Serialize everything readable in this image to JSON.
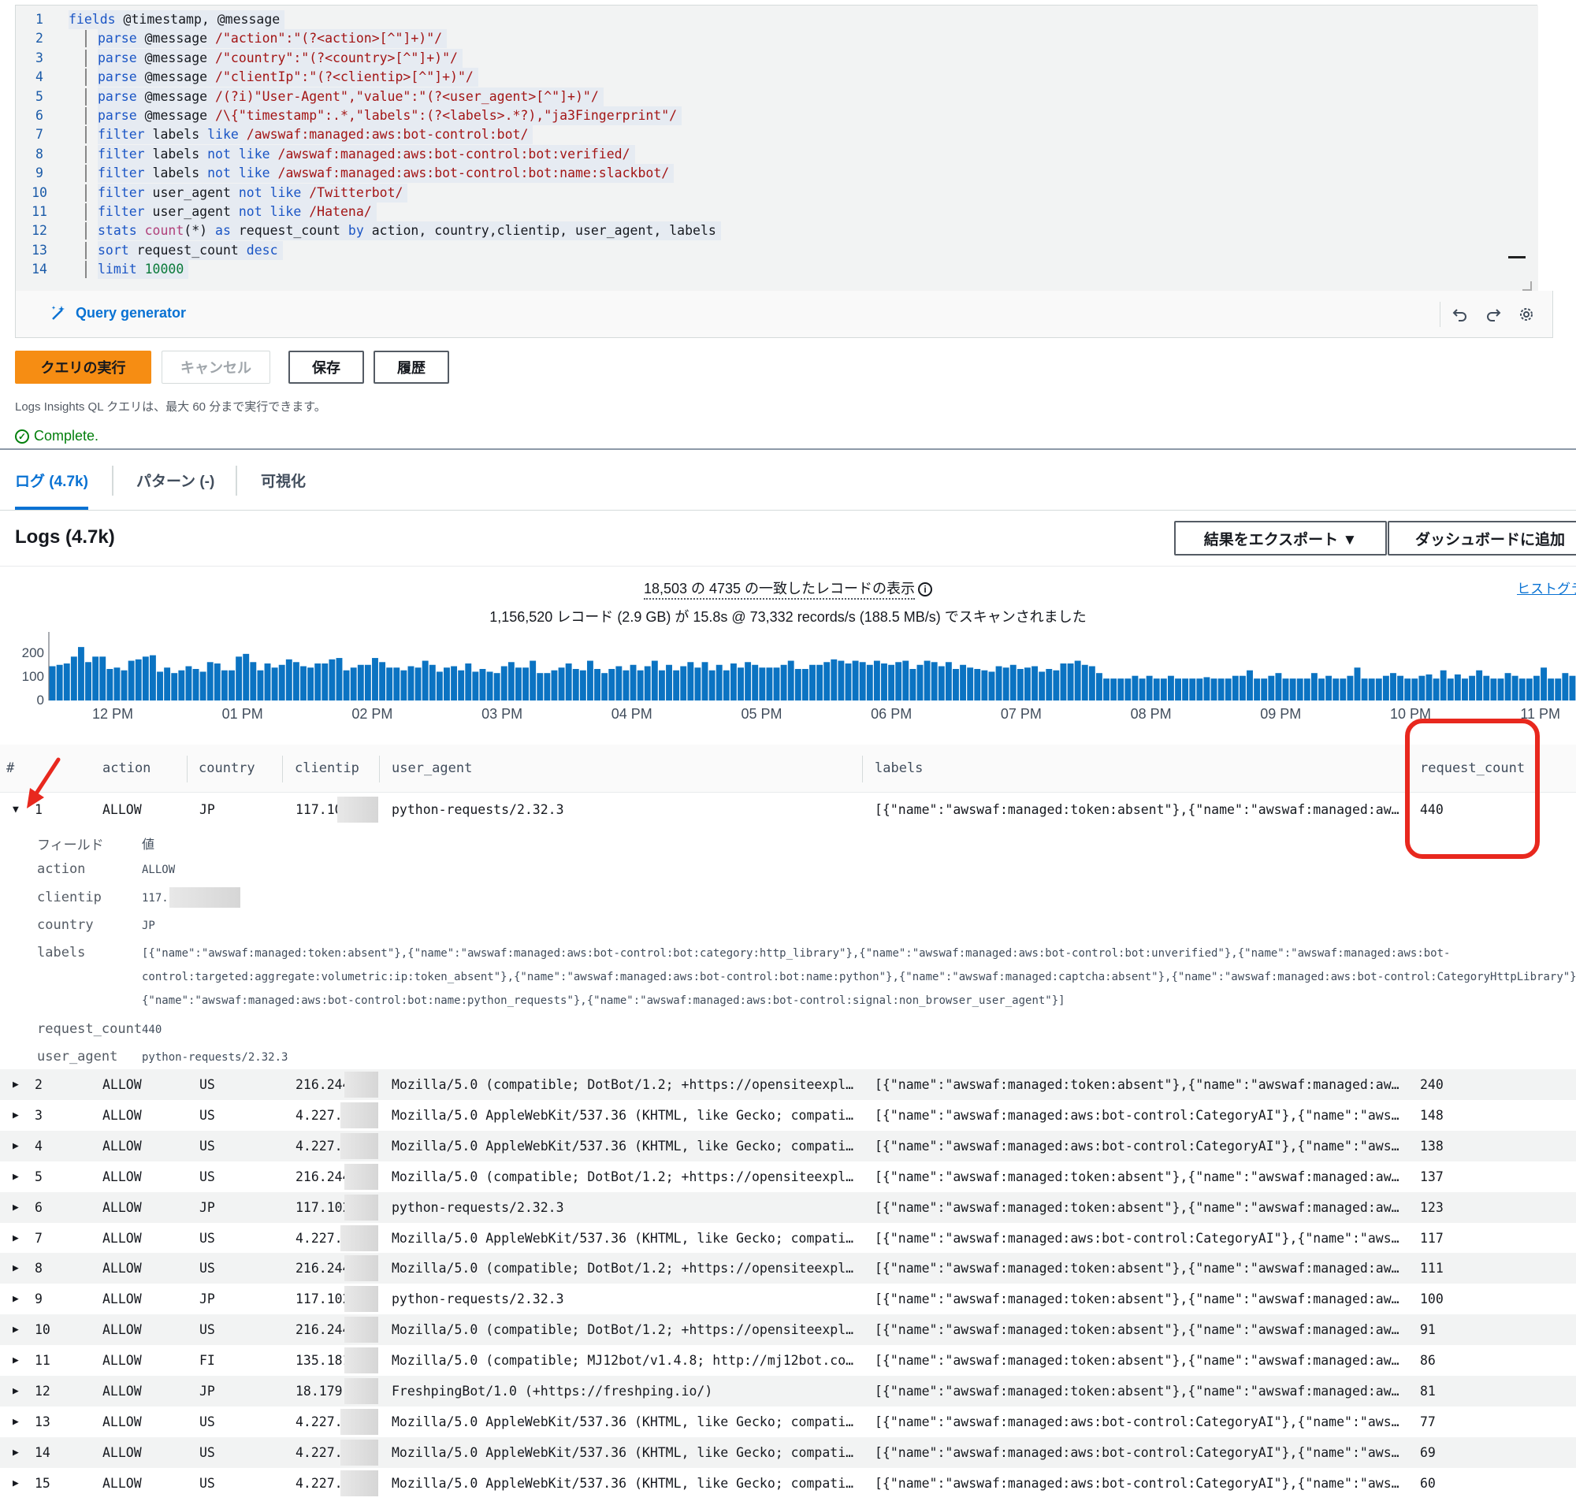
{
  "editor": {
    "line_numbers": [
      "1",
      "2",
      "3",
      "4",
      "5",
      "6",
      "7",
      "8",
      "9",
      "10",
      "11",
      "12",
      "13",
      "14"
    ],
    "query_generator_label": "Query generator"
  },
  "actions": {
    "run": "クエリの実行",
    "cancel": "キャンセル",
    "save": "保存",
    "history": "履歴",
    "hint": "Logs Insights QL クエリは、最大 60 分まで実行できます。",
    "status": "Complete."
  },
  "tabs": [
    {
      "label": "ログ (4.7k)",
      "active": true
    },
    {
      "label": "パターン (-)",
      "active": false
    },
    {
      "label": "可視化",
      "active": false
    }
  ],
  "logs_panel": {
    "title": "Logs (4.7k)",
    "export_label": "結果をエクスポート ▼",
    "dashboard_label": "ダッシュボードに追加",
    "matched_text": "18,503 の 4735 の一致したレコードの表示",
    "scanned_text": "1,156,520 レコード (2.9 GB) が 15.8s @ 73,332 records/s (188.5 MB/s) でスキャンされました",
    "histogram_link": "ヒストグラ"
  },
  "chart_data": {
    "type": "bar",
    "y_ticks": [
      "200",
      "100",
      "0"
    ],
    "x_ticks": [
      "12 PM",
      "01 PM",
      "02 PM",
      "03 PM",
      "04 PM",
      "05 PM",
      "06 PM",
      "07 PM",
      "08 PM",
      "09 PM",
      "10 PM",
      "11 PM"
    ],
    "ylim": [
      0,
      250
    ],
    "color": "#0b73c2",
    "values": [
      125,
      130,
      135,
      160,
      195,
      140,
      160,
      160,
      115,
      120,
      110,
      145,
      150,
      160,
      165,
      105,
      120,
      100,
      110,
      125,
      115,
      105,
      140,
      135,
      110,
      110,
      160,
      170,
      140,
      110,
      135,
      120,
      130,
      150,
      140,
      125,
      120,
      135,
      135,
      150,
      155,
      110,
      120,
      130,
      130,
      155,
      140,
      120,
      120,
      110,
      125,
      120,
      145,
      130,
      105,
      120,
      125,
      110,
      135,
      105,
      115,
      105,
      100,
      125,
      140,
      120,
      120,
      145,
      100,
      100,
      110,
      120,
      135,
      115,
      110,
      145,
      115,
      100,
      115,
      125,
      110,
      130,
      110,
      125,
      145,
      110,
      130,
      110,
      125,
      140,
      120,
      140,
      110,
      130,
      110,
      135,
      120,
      140,
      130,
      120,
      120,
      120,
      130,
      145,
      115,
      115,
      130,
      130,
      140,
      150,
      145,
      135,
      145,
      140,
      130,
      145,
      135,
      130,
      140,
      145,
      115,
      130,
      145,
      140,
      125,
      140,
      115,
      130,
      120,
      115,
      110,
      105,
      125,
      120,
      130,
      115,
      120,
      125,
      105,
      115,
      110,
      135,
      135,
      145,
      130,
      125,
      100,
      80,
      80,
      80,
      80,
      90,
      80,
      90,
      80,
      80,
      90,
      80,
      80,
      80,
      80,
      85,
      80,
      80,
      80,
      90,
      90,
      110,
      80,
      80,
      90,
      100,
      80,
      80,
      80,
      80,
      100,
      80,
      90,
      80,
      80,
      90,
      120,
      80,
      80,
      80,
      90,
      100,
      90,
      80,
      80,
      90,
      95,
      80,
      110,
      80,
      95,
      80,
      90,
      110,
      90,
      80,
      80,
      100,
      90,
      80,
      80,
      90,
      120,
      80,
      80,
      100,
      90
    ]
  },
  "table": {
    "headers": {
      "num": "#",
      "action": "action",
      "country": "country",
      "clientip": "clientip",
      "user_agent": "user_agent",
      "labels": "labels",
      "request_count": "request_count"
    },
    "rows": [
      {
        "num": "1",
        "action": "ALLOW",
        "country": "JP",
        "clientip": "117.10",
        "user_agent": "python-requests/2.32.3",
        "labels": "[{\"name\":\"awswaf:managed:token:absent\"},{\"name\":\"awswaf:managed:aws:…",
        "count": "440"
      },
      {
        "num": "2",
        "action": "ALLOW",
        "country": "US",
        "clientip": "216.244",
        "user_agent": "Mozilla/5.0 (compatible; DotBot/1.2; +https://opensiteexplor…",
        "labels": "[{\"name\":\"awswaf:managed:token:absent\"},{\"name\":\"awswaf:managed:aws:…",
        "count": "240"
      },
      {
        "num": "3",
        "action": "ALLOW",
        "country": "US",
        "clientip": "4.227.3",
        "user_agent": "Mozilla/5.0 AppleWebKit/537.36 (KHTML, like Gecko; compatibl…",
        "labels": "[{\"name\":\"awswaf:managed:aws:bot-control:CategoryAI\"},{\"name\":\"awswa…",
        "count": "148"
      },
      {
        "num": "4",
        "action": "ALLOW",
        "country": "US",
        "clientip": "4.227.3",
        "user_agent": "Mozilla/5.0 AppleWebKit/537.36 (KHTML, like Gecko; compatibl…",
        "labels": "[{\"name\":\"awswaf:managed:aws:bot-control:CategoryAI\"},{\"name\":\"awswa…",
        "count": "138"
      },
      {
        "num": "5",
        "action": "ALLOW",
        "country": "US",
        "clientip": "216.244",
        "user_agent": "Mozilla/5.0 (compatible; DotBot/1.2; +https://opensiteexplor…",
        "labels": "[{\"name\":\"awswaf:managed:token:absent\"},{\"name\":\"awswaf:managed:aws:…",
        "count": "137"
      },
      {
        "num": "6",
        "action": "ALLOW",
        "country": "JP",
        "clientip": "117.102",
        "user_agent": "python-requests/2.32.3",
        "labels": "[{\"name\":\"awswaf:managed:token:absent\"},{\"name\":\"awswaf:managed:aws:…",
        "count": "123"
      },
      {
        "num": "7",
        "action": "ALLOW",
        "country": "US",
        "clientip": "4.227.3",
        "user_agent": "Mozilla/5.0 AppleWebKit/537.36 (KHTML, like Gecko; compatibl…",
        "labels": "[{\"name\":\"awswaf:managed:aws:bot-control:CategoryAI\"},{\"name\":\"awswa…",
        "count": "117"
      },
      {
        "num": "8",
        "action": "ALLOW",
        "country": "US",
        "clientip": "216.244",
        "user_agent": "Mozilla/5.0 (compatible; DotBot/1.2; +https://opensiteexplor…",
        "labels": "[{\"name\":\"awswaf:managed:token:absent\"},{\"name\":\"awswaf:managed:aws:…",
        "count": "111"
      },
      {
        "num": "9",
        "action": "ALLOW",
        "country": "JP",
        "clientip": "117.102",
        "user_agent": "python-requests/2.32.3",
        "labels": "[{\"name\":\"awswaf:managed:token:absent\"},{\"name\":\"awswaf:managed:aws:…",
        "count": "100"
      },
      {
        "num": "10",
        "action": "ALLOW",
        "country": "US",
        "clientip": "216.244",
        "user_agent": "Mozilla/5.0 (compatible; DotBot/1.2; +https://opensiteexplor…",
        "labels": "[{\"name\":\"awswaf:managed:token:absent\"},{\"name\":\"awswaf:managed:aws:…",
        "count": "91"
      },
      {
        "num": "11",
        "action": "ALLOW",
        "country": "FI",
        "clientip": "135.181",
        "user_agent": "Mozilla/5.0 (compatible; MJ12bot/v1.4.8; http://mj12bot.com/)",
        "labels": "[{\"name\":\"awswaf:managed:token:absent\"},{\"name\":\"awswaf:managed:aws:…",
        "count": "86"
      },
      {
        "num": "12",
        "action": "ALLOW",
        "country": "JP",
        "clientip": "18.179.",
        "user_agent": "FreshpingBot/1.0 (+https://freshping.io/)",
        "labels": "[{\"name\":\"awswaf:managed:token:absent\"},{\"name\":\"awswaf:managed:aws:…",
        "count": "81"
      },
      {
        "num": "13",
        "action": "ALLOW",
        "country": "US",
        "clientip": "4.227.3",
        "user_agent": "Mozilla/5.0 AppleWebKit/537.36 (KHTML, like Gecko; compatibl…",
        "labels": "[{\"name\":\"awswaf:managed:aws:bot-control:CategoryAI\"},{\"name\":\"awswa…",
        "count": "77"
      },
      {
        "num": "14",
        "action": "ALLOW",
        "country": "US",
        "clientip": "4.227.3",
        "user_agent": "Mozilla/5.0 AppleWebKit/537.36 (KHTML, like Gecko; compatibl…",
        "labels": "[{\"name\":\"awswaf:managed:aws:bot-control:CategoryAI\"},{\"name\":\"awswa…",
        "count": "69"
      },
      {
        "num": "15",
        "action": "ALLOW",
        "country": "US",
        "clientip": "4.227.3",
        "user_agent": "Mozilla/5.0 AppleWebKit/537.36 (KHTML, like Gecko; compatibl…",
        "labels": "[{\"name\":\"awswaf:managed:aws:bot-control:CategoryAI\"},{\"name\":\"awswa…",
        "count": "60"
      }
    ]
  },
  "detail": {
    "field_header": "フィールド",
    "value_header": "値",
    "action_key": "action",
    "action_val": "ALLOW",
    "clientip_key": "clientip",
    "clientip_val": "117.",
    "country_key": "country",
    "country_val": "JP",
    "labels_key": "labels",
    "labels_line1": "[{\"name\":\"awswaf:managed:token:absent\"},{\"name\":\"awswaf:managed:aws:bot-control:bot:category:http_library\"},{\"name\":\"awswaf:managed:aws:bot-control:bot:unverified\"},{\"name\":\"awswaf:managed:aws:bot-",
    "labels_line2": "control:targeted:aggregate:volumetric:ip:token_absent\"},{\"name\":\"awswaf:managed:aws:bot-control:bot:name:python\"},{\"name\":\"awswaf:managed:captcha:absent\"},{\"name\":\"awswaf:managed:aws:bot-control:CategoryHttpLibrary\"},",
    "labels_line3": "{\"name\":\"awswaf:managed:aws:bot-control:bot:name:python_requests\"},{\"name\":\"awswaf:managed:aws:bot-control:signal:non_browser_user_agent\"}]",
    "request_count_key": "request_count",
    "request_count_val": "440",
    "user_agent_key": "user_agent",
    "user_agent_val": "python-requests/2.32.3"
  },
  "colors": {
    "accent": "#0972d3",
    "run_button": "#f68d13",
    "highlight": "#e8281e",
    "success": "#037f0c"
  }
}
